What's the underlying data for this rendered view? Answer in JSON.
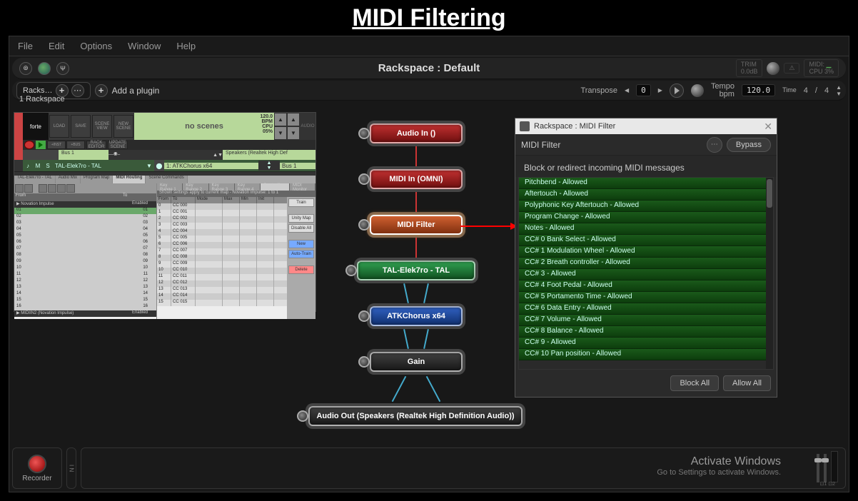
{
  "page_title": "MIDI Filtering",
  "menu": {
    "file": "File",
    "edit": "Edit",
    "options": "Options",
    "window": "Window",
    "help": "Help"
  },
  "titlebar": {
    "title": "Rackspace : Default",
    "trim_label": "TRIM",
    "trim_value": "0.0dB",
    "midi_label": "MIDI:",
    "cpu_label": "CPU",
    "cpu_value": "3%"
  },
  "rack_header": {
    "racks_label": "Racks…",
    "one_rackspace": "1 Rackspace",
    "add_plugin": "Add a plugin",
    "transpose_label": "Transpose",
    "transpose_value": "0",
    "tempo_label": "Tempo",
    "bpm_label": "bpm",
    "tempo_value": "120.0",
    "time_label": "Time",
    "timesig_a": "4",
    "timesig_b": "4"
  },
  "forte": {
    "logo": "forte",
    "btns": [
      "LOAD",
      "SAVE",
      "SCENE\nVIEW",
      "NEW\nSCENE",
      "RACK\nEDITOR",
      "UPDATE\nSCENE"
    ],
    "scene_text": "no scenes",
    "tempo": "120.0",
    "bpm": "BPM",
    "cpu": "CPU",
    "cpu_pct": "05%",
    "ctrl": [
      "+INST",
      "+BUS"
    ],
    "bus_src": "Bus 1",
    "bus_dest": "Speakers (Realtek High Def",
    "track_num": "1",
    "track_name": "TAL-Elek7ro - TAL",
    "plugin_slot_num": "1:",
    "plugin_name": "ATKChorus x64",
    "track_bus": "Bus 1",
    "tabs": [
      "TAL-Elek7ro - TAL",
      "Audio Mix",
      "Program Map",
      "MIDI Routing",
      "Scene Commands"
    ],
    "col_from": "From",
    "col_to": "To",
    "enabled": "Enabled",
    "devices": [
      "Novation Impulse",
      "01",
      "02",
      "03",
      "04",
      "05",
      "06",
      "07",
      "08",
      "09",
      "10",
      "11",
      "12",
      "13",
      "14",
      "15",
      "16",
      "MIDIIN2 (Novation Impulse)"
    ],
    "right_tabs": [
      "Key Range 1",
      "Key Range 2",
      "Key Range 3",
      "Key Range 4",
      "Controllers",
      "MIDI Monitor"
    ],
    "note": "Shown settings apply to current map - Novation Impulse: 1 to 1",
    "cc_cols": [
      "From",
      "To",
      "Mode",
      "Max",
      "Min",
      "Init"
    ],
    "cc_rows": [
      [
        "0",
        "CC 000",
        "",
        "",
        "",
        ""
      ],
      [
        "1",
        "CC 001",
        "",
        "",
        "",
        ""
      ],
      [
        "2",
        "CC 002",
        "",
        "",
        "",
        ""
      ],
      [
        "3",
        "CC 003",
        "",
        "",
        "",
        ""
      ],
      [
        "4",
        "CC 004",
        "",
        "",
        "",
        ""
      ],
      [
        "5",
        "CC 005",
        "",
        "",
        "",
        ""
      ],
      [
        "6",
        "CC 006",
        "",
        "",
        "",
        ""
      ],
      [
        "7",
        "CC 007",
        "",
        "",
        "",
        ""
      ],
      [
        "8",
        "CC 008",
        "",
        "",
        "",
        ""
      ],
      [
        "9",
        "CC 009",
        "",
        "",
        "",
        ""
      ],
      [
        "10",
        "CC 010",
        "",
        "",
        "",
        ""
      ],
      [
        "11",
        "CC 011",
        "",
        "",
        "",
        ""
      ],
      [
        "12",
        "CC 012",
        "",
        "",
        "",
        ""
      ],
      [
        "13",
        "CC 013",
        "",
        "",
        "",
        ""
      ],
      [
        "14",
        "CC 014",
        "",
        "",
        "",
        ""
      ],
      [
        "15",
        "CC 015",
        "",
        "",
        "",
        ""
      ]
    ],
    "side_btns": {
      "train": "Train",
      "unitymap": "Unity Map",
      "disableall": "Disable All",
      "new": "New",
      "autotrain": "Auto-Train",
      "delete": "Delete"
    }
  },
  "nodes": {
    "audio_in": "Audio In ()",
    "midi_in": "MIDI In (OMNI)",
    "midi_filter": "MIDI Filter",
    "tal": "TAL-Elek7ro - TAL",
    "atk": "ATKChorus x64",
    "gain": "Gain",
    "audio_out": "Audio Out (Speakers (Realtek High Definition Audio))"
  },
  "mf": {
    "window_title": "Rackspace : MIDI Filter",
    "name": "MIDI Filter",
    "bypass": "Bypass",
    "desc": "Block or redirect incoming MIDI messages",
    "items": [
      "Pitchbend - Allowed",
      "Aftertouch - Allowed",
      "Polyphonic Key Aftertouch - Allowed",
      "Program Change - Allowed",
      "Notes - Allowed",
      "CC# 0 Bank Select - Allowed",
      "CC# 1 Modulation Wheel - Allowed",
      "CC# 2 Breath controller - Allowed",
      "CC# 3 - Allowed",
      "CC# 4 Foot Pedal - Allowed",
      "CC# 5 Portamento Time - Allowed",
      "CC# 6 Data Entry - Allowed",
      "CC# 7 Volume - Allowed",
      "CC# 8 Balance - Allowed",
      "CC# 9 - Allowed",
      "CC# 10 Pan position - Allowed"
    ],
    "block_all": "Block All",
    "allow_all": "Allow All"
  },
  "bottom": {
    "recorder": "Recorder",
    "in": "I N",
    "activate1": "Activate Windows",
    "activate2": "Go to Settings to activate Windows.",
    "ch12": "⊡1  ⊡2"
  }
}
